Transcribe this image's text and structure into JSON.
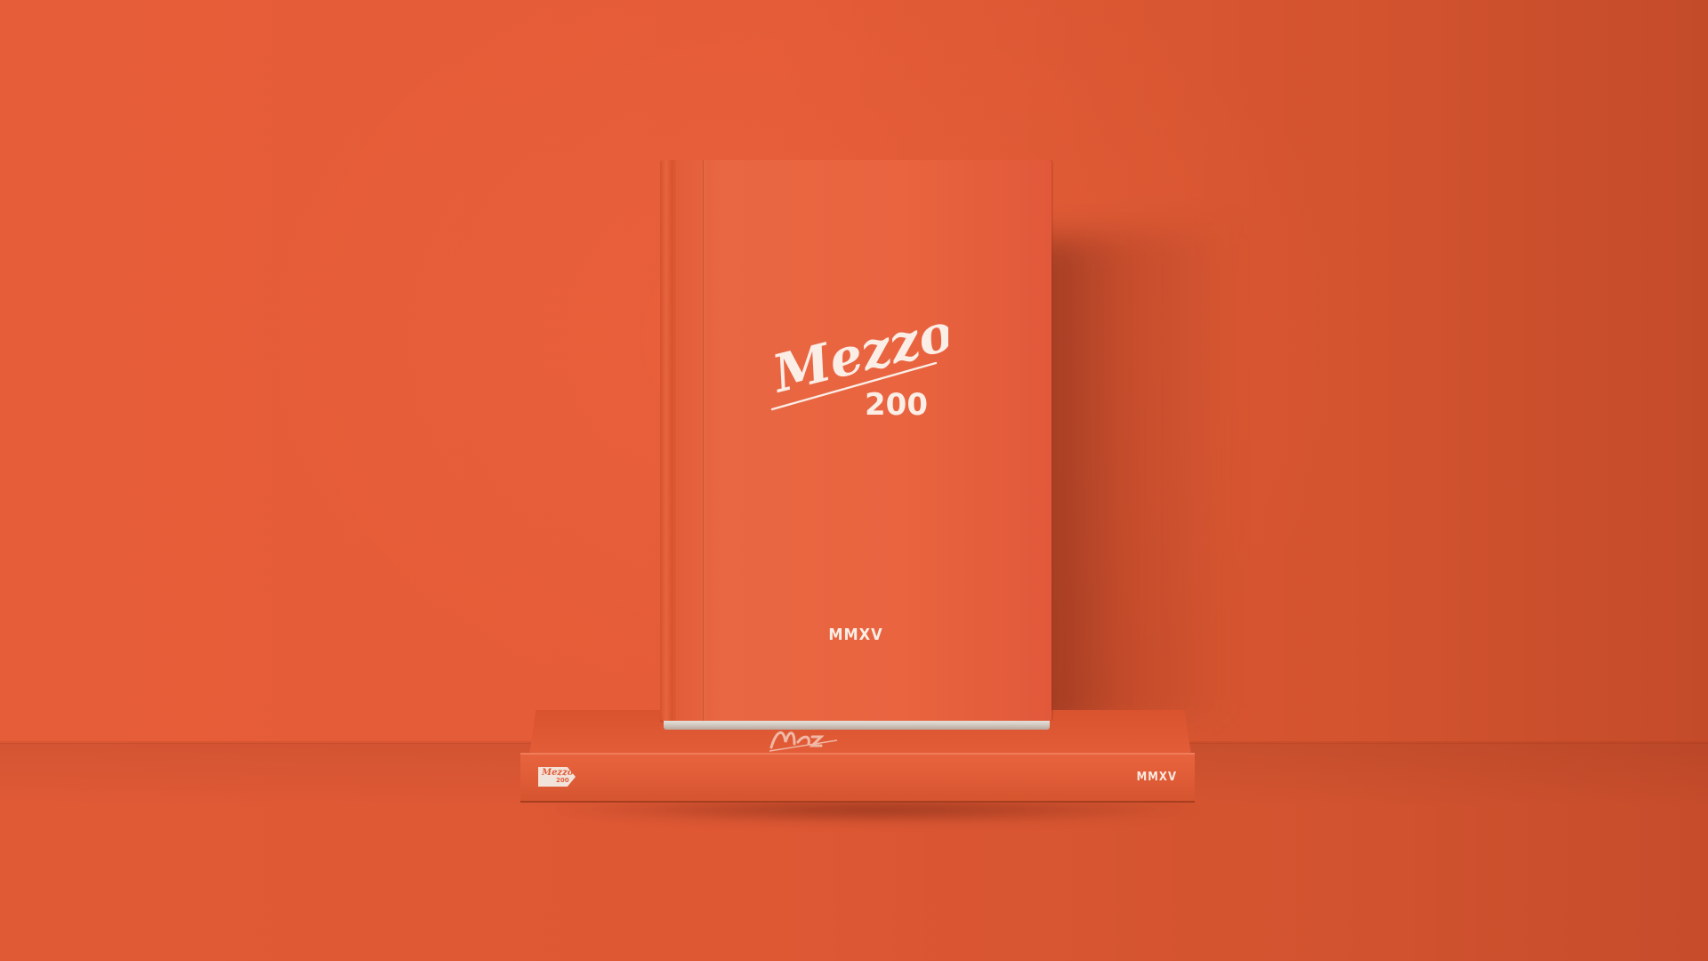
{
  "scene": {
    "background_color": "#e35c38",
    "floor_color": "#dc5834"
  },
  "standing_book": {
    "title_script": "Mezzo",
    "number": "200",
    "year": "MMXV",
    "cover_color": "#e9643f",
    "ink_color": "#fbeee6"
  },
  "lying_book": {
    "spine_logo_script": "Mezzo",
    "spine_logo_number": "200",
    "spine_year": "MMXV",
    "spine_color": "#e2603b"
  }
}
